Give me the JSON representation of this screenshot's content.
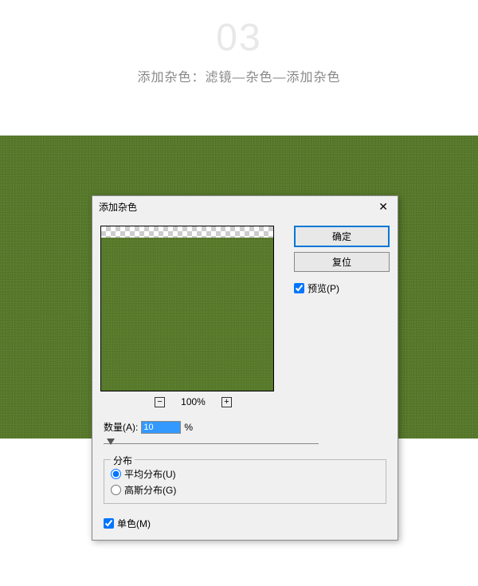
{
  "step": {
    "number": "03",
    "description": "添加杂色：滤镜—杂色—添加杂色"
  },
  "dialog": {
    "title": "添加杂色",
    "close": "✕",
    "ok_label": "确定",
    "reset_label": "复位",
    "preview_label": "预览(P)",
    "zoom_value": "100%",
    "amount_label": "数量(A):",
    "amount_value": "10",
    "amount_unit": "%",
    "dist_legend": "分布",
    "dist_uniform": "平均分布(U)",
    "dist_gaussian": "高斯分布(G)",
    "mono_label": "单色(M)"
  }
}
